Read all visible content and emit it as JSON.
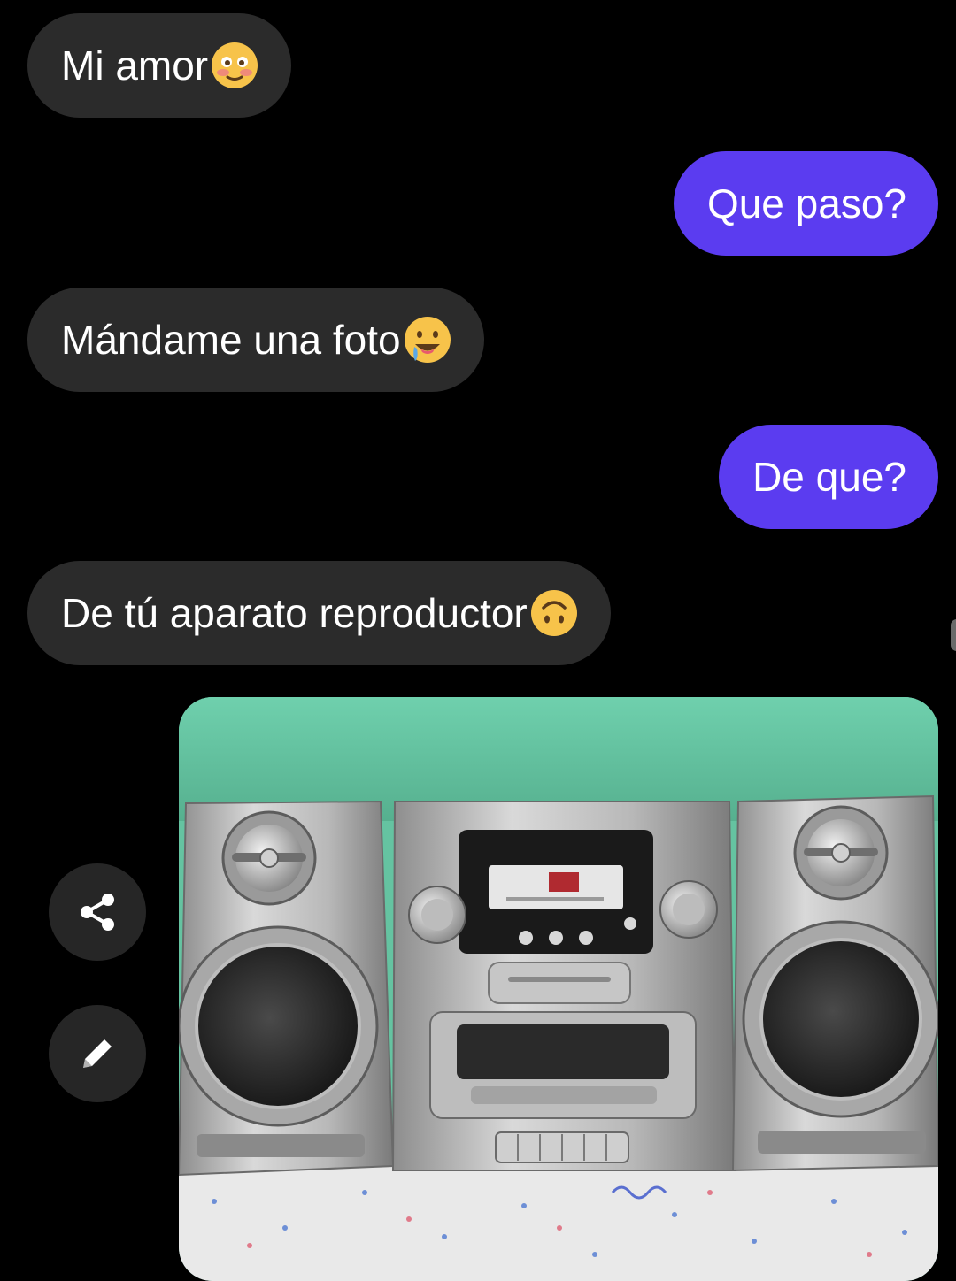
{
  "messages": [
    {
      "side": "incoming",
      "text": "Mi amor",
      "emoji": "flushed-smiling-face-emoji"
    },
    {
      "side": "outgoing",
      "text": "Que paso?"
    },
    {
      "side": "incoming",
      "text": "Mándame una foto",
      "emoji": "drooling-face-emoji"
    },
    {
      "side": "outgoing",
      "text": "De que?"
    },
    {
      "side": "incoming",
      "text": "De tú aparato reproductor",
      "emoji": "upside-down-face-emoji"
    }
  ],
  "attachment": {
    "type": "photo",
    "subject": "silver-mini-hifi-stereo-system"
  },
  "actions": {
    "share_icon": "share-icon",
    "edit_icon": "pencil-icon"
  },
  "colors": {
    "background": "#000000",
    "incoming_bubble": "#2b2b2b",
    "outgoing_bubble": "#5b3cf0",
    "text": "#ffffff"
  }
}
